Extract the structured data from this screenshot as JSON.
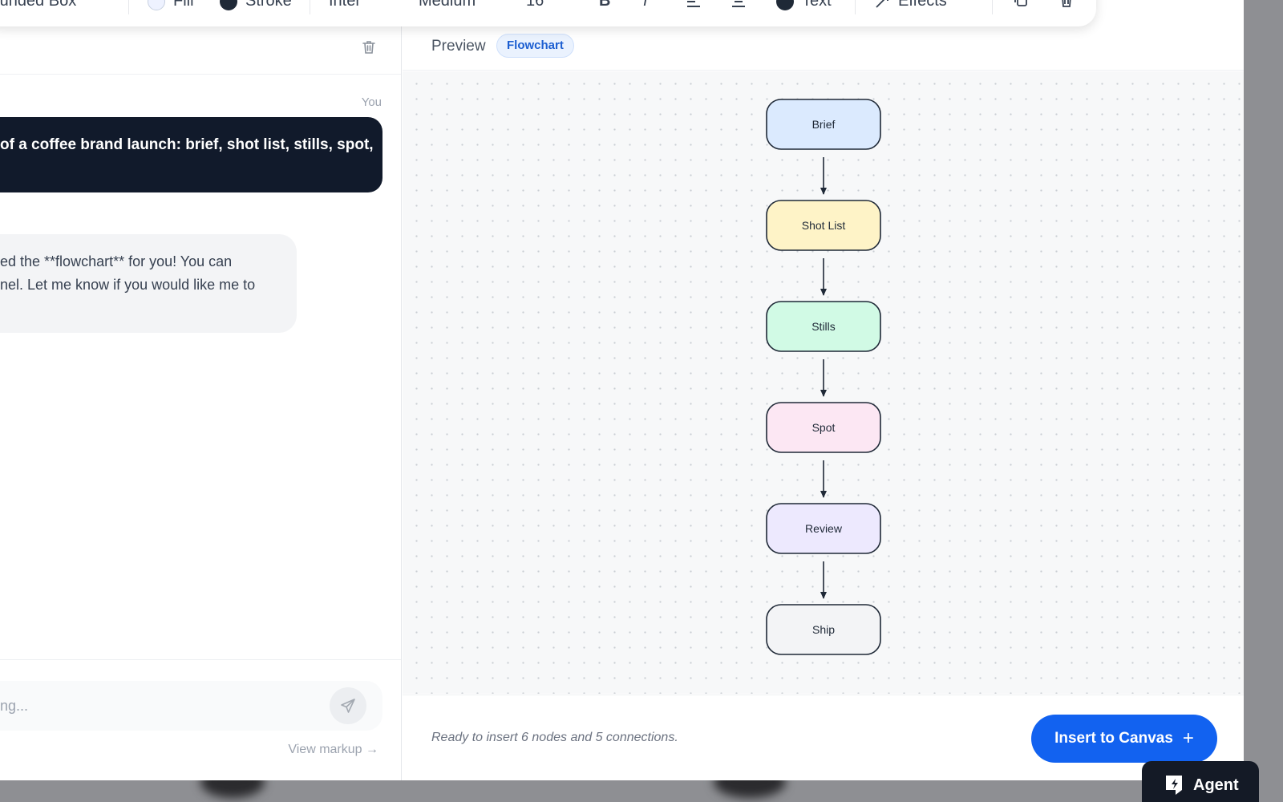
{
  "toolbar": {
    "shape": "Rounded Box",
    "fill_label": "Fill",
    "stroke_label": "Stroke",
    "font": "Inter",
    "weight": "Medium",
    "size": "16",
    "bold": "B",
    "italic": "I",
    "text_label": "Text",
    "effects_label": "Effects",
    "fill_color": "#eef2ff",
    "stroke_color": "#1f2937",
    "text_color": "#1f2937"
  },
  "chat": {
    "you_label": "You",
    "user_message": "of a coffee brand launch: brief, shot list, stills, spot,",
    "assistant_lines": [
      "ed the **flowchart** for you! You can",
      "nel. Let me know if you would like me to"
    ],
    "input_placeholder": "ng...",
    "view_markup": "View markup →"
  },
  "preview": {
    "title": "Preview",
    "badge": "Flowchart",
    "status": "Ready to insert 6 nodes and 5 connections.",
    "insert_button": "Insert to Canvas",
    "insert_icon": "+"
  },
  "flowchart": {
    "nodes": [
      {
        "label": "Brief",
        "fill": "#dbeafe"
      },
      {
        "label": "Shot List",
        "fill": "#fef3c7"
      },
      {
        "label": "Stills",
        "fill": "#d1fae5"
      },
      {
        "label": "Spot",
        "fill": "#fce7f3"
      },
      {
        "label": "Review",
        "fill": "#ede9fe"
      },
      {
        "label": "Ship",
        "fill": "#f3f4f6"
      }
    ],
    "edges": [
      {
        "from": "Brief",
        "to": "Shot List"
      },
      {
        "from": "Shot List",
        "to": "Stills"
      },
      {
        "from": "Stills",
        "to": "Spot"
      },
      {
        "from": "Spot",
        "to": "Review"
      },
      {
        "from": "Review",
        "to": "Ship"
      }
    ],
    "stroke": "#1f2937"
  },
  "agent": {
    "label": "Agent"
  }
}
